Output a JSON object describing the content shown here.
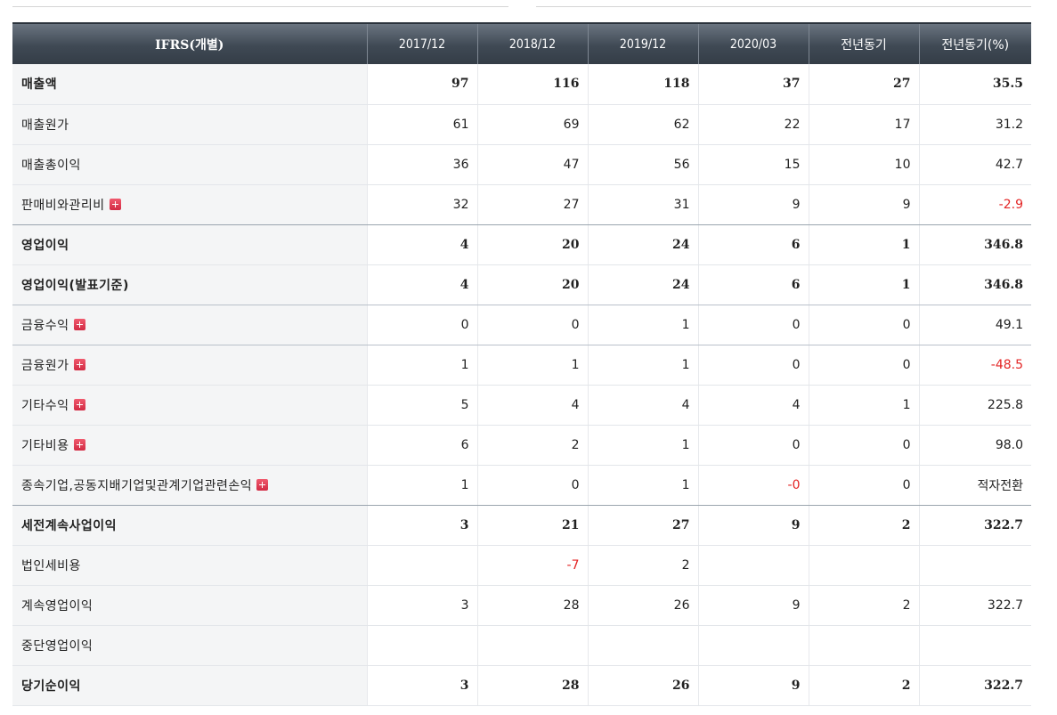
{
  "table": {
    "header": {
      "account": "IFRS(개별)",
      "columns": [
        "2017/12",
        "2018/12",
        "2019/12",
        "2020/03",
        "전년동기",
        "전년동기(%)"
      ]
    },
    "rows": [
      {
        "label": "매출액",
        "bold": true,
        "expandable": false,
        "values": [
          "97",
          "116",
          "118",
          "37",
          "27",
          "35.5"
        ],
        "negative": []
      },
      {
        "label": "매출원가",
        "bold": false,
        "expandable": false,
        "values": [
          "61",
          "69",
          "62",
          "22",
          "17",
          "31.2"
        ],
        "negative": []
      },
      {
        "label": "매출총이익",
        "bold": false,
        "expandable": false,
        "values": [
          "36",
          "47",
          "56",
          "15",
          "10",
          "42.7"
        ],
        "negative": []
      },
      {
        "label": "판매비와관리비",
        "bold": false,
        "expandable": true,
        "values": [
          "32",
          "27",
          "31",
          "9",
          "9",
          "-2.9"
        ],
        "negative": [
          5
        ]
      },
      {
        "label": "영업이익",
        "bold": true,
        "expandable": false,
        "values": [
          "4",
          "20",
          "24",
          "6",
          "1",
          "346.8"
        ],
        "negative": []
      },
      {
        "label": "영업이익(발표기준)",
        "bold": true,
        "expandable": false,
        "values": [
          "4",
          "20",
          "24",
          "6",
          "1",
          "346.8"
        ],
        "negative": []
      },
      {
        "label": "금융수익",
        "bold": false,
        "expandable": true,
        "values": [
          "0",
          "0",
          "1",
          "0",
          "0",
          "49.1"
        ],
        "negative": []
      },
      {
        "label": "금융원가",
        "bold": false,
        "expandable": true,
        "values": [
          "1",
          "1",
          "1",
          "0",
          "0",
          "-48.5"
        ],
        "negative": [
          5
        ]
      },
      {
        "label": "기타수익",
        "bold": false,
        "expandable": true,
        "values": [
          "5",
          "4",
          "4",
          "4",
          "1",
          "225.8"
        ],
        "negative": []
      },
      {
        "label": "기타비용",
        "bold": false,
        "expandable": true,
        "values": [
          "6",
          "2",
          "1",
          "0",
          "0",
          "98.0"
        ],
        "negative": []
      },
      {
        "label": "종속기업,공동지배기업및관계기업관련손익",
        "bold": false,
        "expandable": true,
        "values": [
          "1",
          "0",
          "1",
          "-0",
          "0",
          "적자전환"
        ],
        "negative": [
          3
        ]
      },
      {
        "label": "세전계속사업이익",
        "bold": true,
        "expandable": false,
        "values": [
          "3",
          "21",
          "27",
          "9",
          "2",
          "322.7"
        ],
        "negative": []
      },
      {
        "label": "법인세비용",
        "bold": false,
        "expandable": false,
        "values": [
          "",
          "-7",
          "2",
          "",
          "",
          ""
        ],
        "negative": [
          1
        ]
      },
      {
        "label": "계속영업이익",
        "bold": false,
        "expandable": false,
        "values": [
          "3",
          "28",
          "26",
          "9",
          "2",
          "322.7"
        ],
        "negative": []
      },
      {
        "label": "중단영업이익",
        "bold": false,
        "expandable": false,
        "values": [
          "",
          "",
          "",
          "",
          "",
          ""
        ],
        "negative": []
      },
      {
        "label": "당기순이익",
        "bold": true,
        "expandable": false,
        "values": [
          "3",
          "28",
          "26",
          "9",
          "2",
          "322.7"
        ],
        "negative": []
      }
    ]
  },
  "colors": {
    "header_bg": "#3f4954",
    "negative": "#e32525",
    "expand_icon": "#d22a43",
    "label_bg": "#f4f5f6"
  },
  "icons": {
    "expand": "plus-square-icon"
  }
}
